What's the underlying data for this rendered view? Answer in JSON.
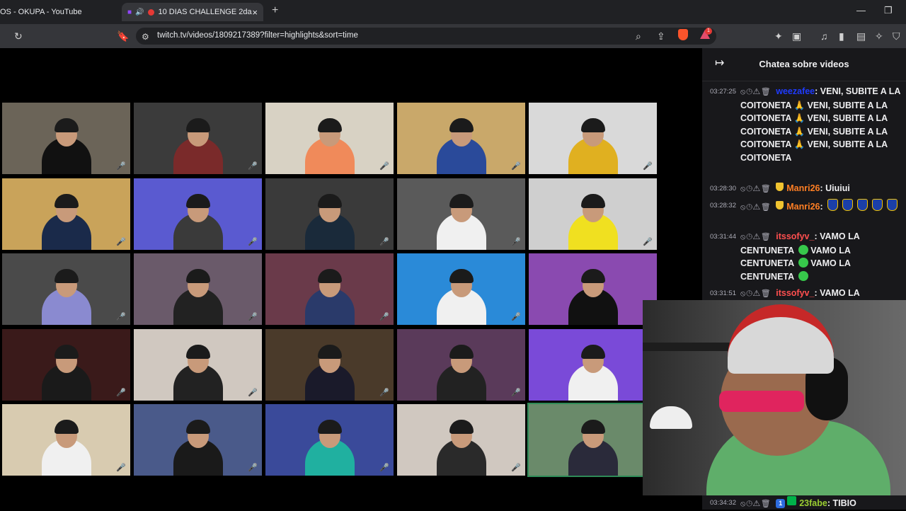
{
  "browser": {
    "tabs": [
      {
        "title": "OS - OKUPA - YouTube"
      },
      {
        "title": "10 DIAS CHALLENGE 2da"
      }
    ],
    "new_tab_symbol": "+",
    "close_symbol": "×",
    "url": "twitch.tv/videos/1809217389?filter=highlights&sort=time",
    "rewards_badge": "1"
  },
  "chat": {
    "title": "Chatea sobre videos",
    "messages": [
      {
        "ts": "03:27:25",
        "user": "weezafee",
        "user_color": "#1f3bff",
        "text": ": VENI, SUBITE A LA COITONETA 🙏 VENI, SUBITE A LA COITONETA 🙏 VENI, SUBITE A LA COITONETA 🙏 VENI, SUBITE A LA COITONETA 🙏 VENI, SUBITE A LA COITONETA"
      },
      {
        "ts": "03:28:30",
        "user": "Manri26",
        "user_color": "#ff7f24",
        "text": ": Uiuiui"
      },
      {
        "ts": "03:28:32",
        "user": "Manri26",
        "user_color": "#ff7f24",
        "text": ":"
      },
      {
        "ts": "03:31:44",
        "user": "itssofyv_",
        "user_color": "#ff4f4f",
        "text": ": VAMO LA CENTUNETA",
        "text2": "VAMO LA CENTUNETA",
        "text3": "VAMO LA CENTUNETA"
      },
      {
        "ts": "03:31:51",
        "user": "itssofyv_",
        "user_color": "#ff4f4f",
        "text": ": VAMO LA"
      },
      {
        "ts": "03:34:32",
        "user": "23fabe",
        "user_color": "#9acd32",
        "text": ": TIBIO"
      }
    ]
  },
  "colors": {
    "chat_bg": "#18181b",
    "browser_frame": "#202124",
    "highlight_border": "#2e8b57"
  }
}
